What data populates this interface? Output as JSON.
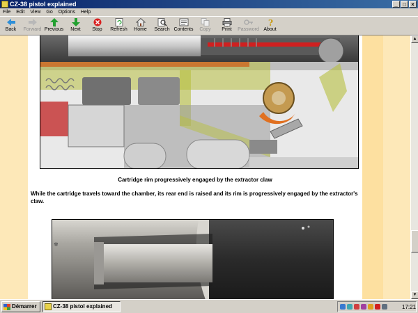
{
  "window": {
    "title": "CZ-38 pistol explained",
    "controls": [
      "_",
      "□",
      "×"
    ]
  },
  "menu": [
    "File",
    "Edit",
    "View",
    "Go",
    "Options",
    "Help"
  ],
  "toolbar": [
    {
      "label": "Back",
      "icon": "back-arrow-icon",
      "enabled": true
    },
    {
      "label": "Forward",
      "icon": "forward-arrow-icon",
      "enabled": false
    },
    {
      "label": "Previous",
      "icon": "up-arrow-icon",
      "enabled": true
    },
    {
      "label": "Next",
      "icon": "down-arrow-icon",
      "enabled": true
    },
    {
      "label": "Stop",
      "icon": "stop-icon",
      "enabled": true
    },
    {
      "label": "Refresh",
      "icon": "refresh-icon",
      "enabled": true
    },
    {
      "label": "Home",
      "icon": "home-icon",
      "enabled": true
    },
    {
      "label": "Search",
      "icon": "search-icon",
      "enabled": true
    },
    {
      "label": "Contents",
      "icon": "contents-icon",
      "enabled": true
    },
    {
      "label": "Copy",
      "icon": "copy-icon",
      "enabled": false
    },
    {
      "label": "Print",
      "icon": "print-icon",
      "enabled": true
    },
    {
      "label": "Password",
      "icon": "key-icon",
      "enabled": false
    },
    {
      "label": "About",
      "icon": "help-icon",
      "enabled": true
    }
  ],
  "content": {
    "caption": "Cartridge rim progressively engaged by the extractor claw",
    "paragraph": "While the cartridge travels toward the chamber, its rear end is raised and its rim is progressively engaged by the extractor's claw."
  },
  "taskbar": {
    "start_label": "Démarrer",
    "active_task": "CZ-38 pistol explained",
    "clock": "17:21"
  },
  "colors": {
    "accent_band": "#fde0a0",
    "side_band": "#fde8b8",
    "titlebar": "#0a246a"
  }
}
